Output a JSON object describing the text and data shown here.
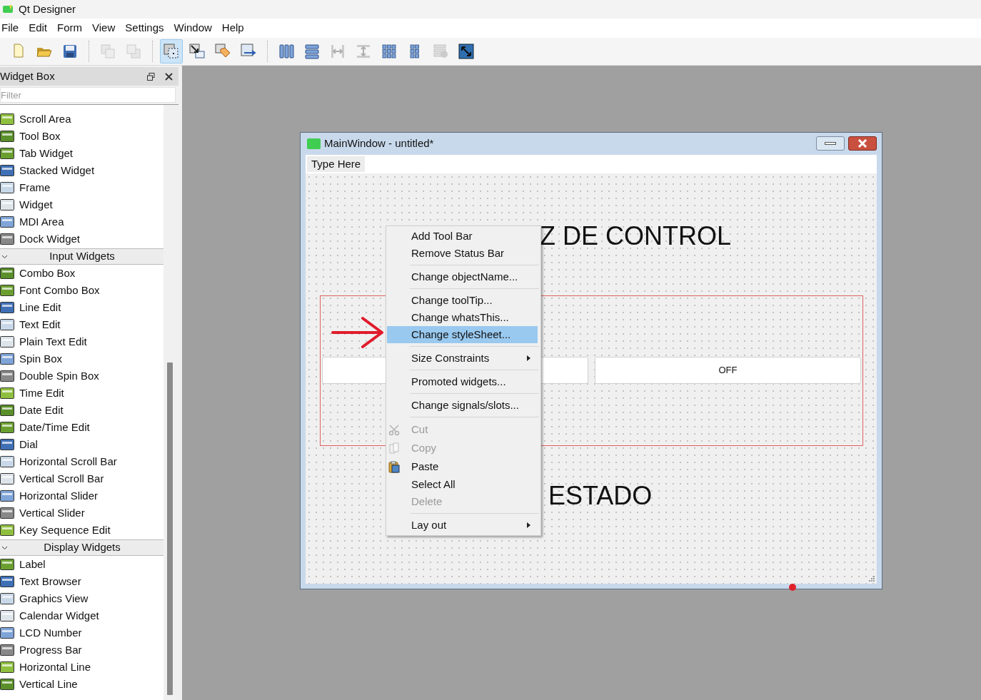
{
  "window": {
    "title": "Qt Designer"
  },
  "menu_bar": [
    "File",
    "Edit",
    "Form",
    "View",
    "Settings",
    "Window",
    "Help"
  ],
  "toolbar": [
    {
      "kind": "new",
      "selected": false,
      "disabled": false
    },
    {
      "kind": "open",
      "selected": false,
      "disabled": false
    },
    {
      "kind": "save",
      "selected": false,
      "disabled": false
    },
    {
      "kind": "separator"
    },
    {
      "kind": "raise",
      "selected": false,
      "disabled": true
    },
    {
      "kind": "lower",
      "selected": false,
      "disabled": true
    },
    {
      "kind": "separator"
    },
    {
      "kind": "edit-widgets",
      "selected": true,
      "disabled": false
    },
    {
      "kind": "edit-signals",
      "selected": false,
      "disabled": false
    },
    {
      "kind": "edit-buddies",
      "selected": false,
      "disabled": false
    },
    {
      "kind": "edit-tab-order",
      "selected": false,
      "disabled": false
    },
    {
      "kind": "separator"
    },
    {
      "kind": "layout-h",
      "selected": false,
      "disabled": false
    },
    {
      "kind": "layout-v",
      "selected": false,
      "disabled": false
    },
    {
      "kind": "splitter-h",
      "selected": false,
      "disabled": true
    },
    {
      "kind": "splitter-v",
      "selected": false,
      "disabled": true
    },
    {
      "kind": "grid",
      "selected": false,
      "disabled": false
    },
    {
      "kind": "form-layout",
      "selected": false,
      "disabled": false
    },
    {
      "kind": "break-layout",
      "selected": false,
      "disabled": true
    },
    {
      "kind": "adjust-size",
      "selected": false,
      "disabled": false
    }
  ],
  "widget_box": {
    "title": "Widget Box",
    "filter_placeholder": "Filter",
    "items": [
      {
        "kind": "widget",
        "label": "Scroll Area"
      },
      {
        "kind": "widget",
        "label": "Tool Box"
      },
      {
        "kind": "widget",
        "label": "Tab Widget"
      },
      {
        "kind": "widget",
        "label": "Stacked Widget"
      },
      {
        "kind": "widget",
        "label": "Frame"
      },
      {
        "kind": "widget",
        "label": "Widget"
      },
      {
        "kind": "widget",
        "label": "MDI Area"
      },
      {
        "kind": "widget",
        "label": "Dock Widget"
      },
      {
        "kind": "category",
        "label": "Input Widgets",
        "expanded": true
      },
      {
        "kind": "widget",
        "label": "Combo Box"
      },
      {
        "kind": "widget",
        "label": "Font Combo Box"
      },
      {
        "kind": "widget",
        "label": "Line Edit"
      },
      {
        "kind": "widget",
        "label": "Text Edit"
      },
      {
        "kind": "widget",
        "label": "Plain Text Edit"
      },
      {
        "kind": "widget",
        "label": "Spin Box"
      },
      {
        "kind": "widget",
        "label": "Double Spin Box"
      },
      {
        "kind": "widget",
        "label": "Time Edit"
      },
      {
        "kind": "widget",
        "label": "Date Edit"
      },
      {
        "kind": "widget",
        "label": "Date/Time Edit"
      },
      {
        "kind": "widget",
        "label": "Dial"
      },
      {
        "kind": "widget",
        "label": "Horizontal Scroll Bar"
      },
      {
        "kind": "widget",
        "label": "Vertical Scroll Bar"
      },
      {
        "kind": "widget",
        "label": "Horizontal Slider"
      },
      {
        "kind": "widget",
        "label": "Vertical Slider"
      },
      {
        "kind": "widget",
        "label": "Key Sequence Edit"
      },
      {
        "kind": "category",
        "label": "Display Widgets",
        "expanded": true
      },
      {
        "kind": "widget",
        "label": "Label"
      },
      {
        "kind": "widget",
        "label": "Text Browser"
      },
      {
        "kind": "widget",
        "label": "Graphics View"
      },
      {
        "kind": "widget",
        "label": "Calendar Widget"
      },
      {
        "kind": "widget",
        "label": "LCD Number"
      },
      {
        "kind": "widget",
        "label": "Progress Bar"
      },
      {
        "kind": "widget",
        "label": "Horizontal Line"
      },
      {
        "kind": "widget",
        "label": "Vertical Line"
      }
    ]
  },
  "form": {
    "title": "MainWindow - untitled*",
    "menu_placeholder": "Type Here",
    "labels": [
      "Z DE CONTROL",
      "ESTADO"
    ],
    "buttons": [
      {
        "kind": "push"
      },
      {
        "kind": "push",
        "label": "OFF"
      }
    ]
  },
  "context_menu": [
    {
      "kind": "plain",
      "label": "Add Tool Bar",
      "selected": false,
      "disabled": false
    },
    {
      "kind": "plain",
      "label": "Remove Status Bar",
      "selected": false,
      "disabled": false
    },
    {
      "kind": "separator"
    },
    {
      "kind": "plain",
      "label": "Change objectName...",
      "selected": false,
      "disabled": false
    },
    {
      "kind": "separator"
    },
    {
      "kind": "plain",
      "label": "Change toolTip...",
      "selected": false,
      "disabled": false
    },
    {
      "kind": "plain",
      "label": "Change whatsThis...",
      "selected": false,
      "disabled": false
    },
    {
      "kind": "plain",
      "label": "Change styleSheet...",
      "selected": true,
      "disabled": false
    },
    {
      "kind": "separator"
    },
    {
      "kind": "submenu",
      "label": "Size Constraints",
      "selected": false,
      "disabled": false
    },
    {
      "kind": "separator"
    },
    {
      "kind": "plain",
      "label": "Promoted widgets...",
      "selected": false,
      "disabled": false
    },
    {
      "kind": "separator"
    },
    {
      "kind": "plain",
      "label": "Change signals/slots...",
      "selected": false,
      "disabled": false
    },
    {
      "kind": "separator"
    },
    {
      "kind": "cut",
      "label": "Cut",
      "selected": false,
      "disabled": true
    },
    {
      "kind": "copy",
      "label": "Copy",
      "selected": false,
      "disabled": true
    },
    {
      "kind": "paste",
      "label": "Paste",
      "selected": false,
      "disabled": false
    },
    {
      "kind": "plain",
      "label": "Select All",
      "selected": false,
      "disabled": false
    },
    {
      "kind": "plain",
      "label": "Delete",
      "selected": false,
      "disabled": true
    },
    {
      "kind": "separator"
    },
    {
      "kind": "submenu",
      "label": "Lay out",
      "selected": false,
      "disabled": false
    }
  ]
}
